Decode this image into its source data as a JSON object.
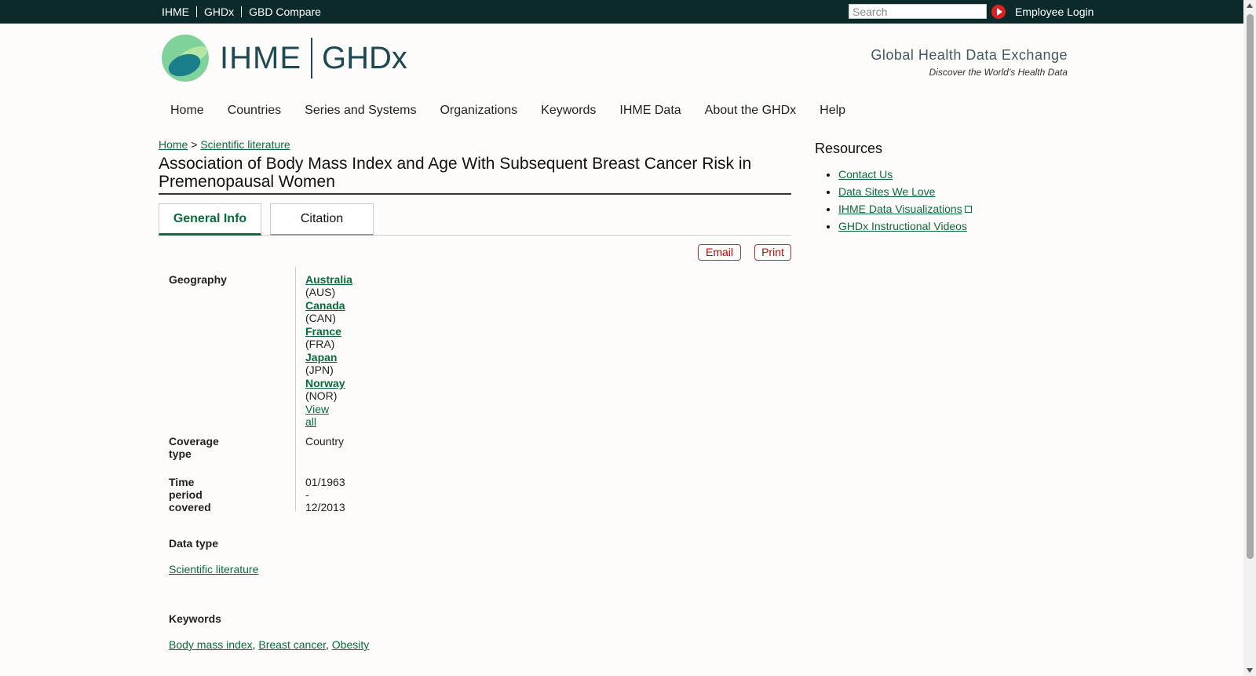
{
  "topbar": {
    "links": [
      "IHME",
      "GHDx",
      "GBD Compare"
    ],
    "search_placeholder": "Search",
    "login": "Employee Login"
  },
  "logo": {
    "ihme": "IHME",
    "ghdx": "GHDx"
  },
  "tagline": {
    "title": "Global Health Data Exchange",
    "subtitle": "Discover the World’s Health Data"
  },
  "nav": [
    "Home",
    "Countries",
    "Series and Systems",
    "Organizations",
    "Keywords",
    "IHME Data",
    "About the GHDx",
    "Help"
  ],
  "breadcrumb": {
    "home": "Home",
    "sep": ">",
    "section": "Scientific literature"
  },
  "page_title": "Association of Body Mass Index and Age With Subsequent Breast Cancer Risk in Premenopausal Women",
  "tabs": {
    "general": "General Info",
    "citation": "Citation"
  },
  "actions": {
    "email": "Email",
    "print": "Print"
  },
  "info": {
    "geography_label": "Geography",
    "countries": [
      {
        "name": "Australia",
        "code": "(AUS)"
      },
      {
        "name": "Canada",
        "code": "(CAN)"
      },
      {
        "name": "France",
        "code": "(FRA)"
      },
      {
        "name": "Japan",
        "code": "(JPN)"
      },
      {
        "name": "Norway",
        "code": "(NOR)"
      }
    ],
    "view_all": "View all",
    "coverage_label": "Coverage type",
    "coverage_value": "Country",
    "time_label": "Time period covered",
    "time_value": "01/1963 - 12/2013"
  },
  "data_type": {
    "label": "Data type",
    "value": "Scientific literature"
  },
  "keywords": {
    "label": "Keywords",
    "items": [
      "Body mass index",
      "Breast cancer",
      "Obesity"
    ],
    "sep": ","
  },
  "resources": {
    "title": "Resources",
    "items": [
      "Contact Us",
      "Data Sites We Love",
      "IHME Data Visualizations",
      "GHDx Instructional Videos"
    ]
  },
  "colors": {
    "topbar": "#0c2a2a",
    "link": "#0b6b3a",
    "action_red": "#cc0000"
  }
}
